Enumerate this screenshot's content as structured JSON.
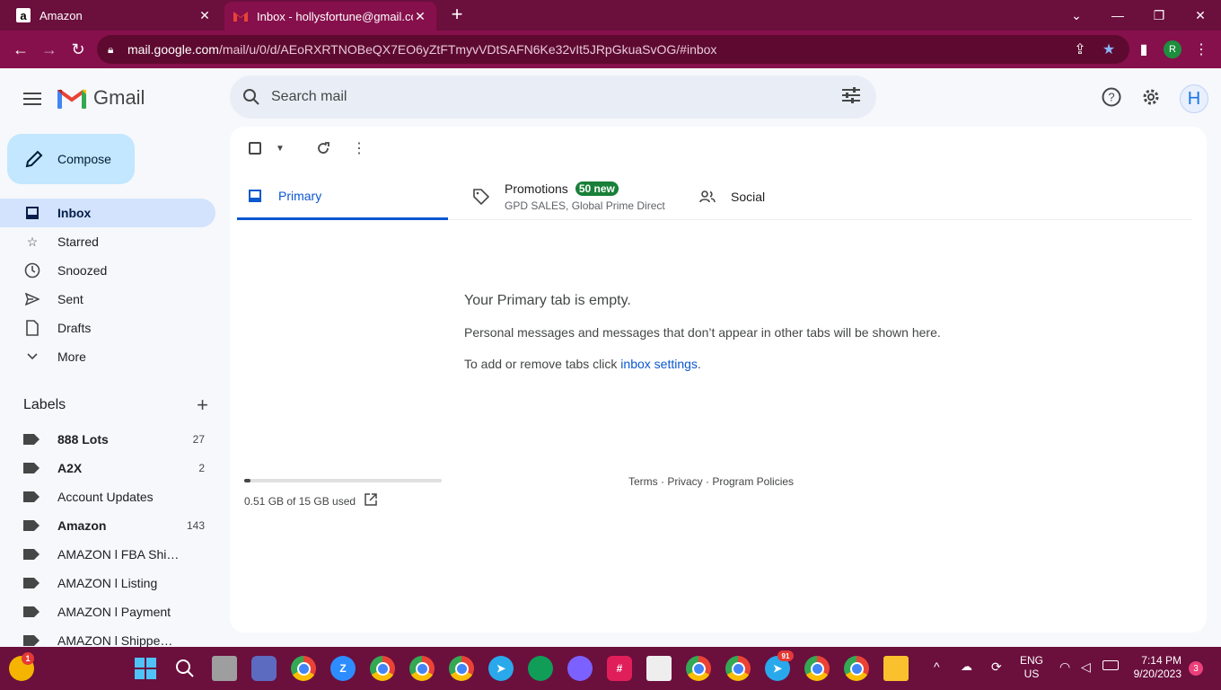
{
  "browser": {
    "tabs": [
      {
        "title": "Amazon",
        "favicon": "amazon-icon"
      },
      {
        "title": "Inbox - hollysfortune@gmail.com",
        "favicon": "gmail-icon"
      }
    ],
    "url_host": "mail.google.com",
    "url_path": "/mail/u/0/d/AEoRXRTNOBeQX7EO6yZtFTmyvVDtSAFN6Ke32vIt5JRpGkuaSvOG/#inbox",
    "profile_initial": "R",
    "theme_color": "#86104c"
  },
  "gmail": {
    "logo_text": "Gmail",
    "search_placeholder": "Search mail",
    "avatar_initial": "H",
    "compose_label": "Compose",
    "nav": [
      {
        "label": "Inbox",
        "icon": "inbox-icon",
        "active": true
      },
      {
        "label": "Starred",
        "icon": "star-icon"
      },
      {
        "label": "Snoozed",
        "icon": "clock-icon"
      },
      {
        "label": "Sent",
        "icon": "send-icon"
      },
      {
        "label": "Drafts",
        "icon": "draft-icon"
      },
      {
        "label": "More",
        "icon": "chevron-down-icon"
      }
    ],
    "labels_title": "Labels",
    "labels": [
      {
        "name": "888 Lots",
        "count": "27",
        "bold": true
      },
      {
        "name": "A2X",
        "count": "2",
        "bold": true
      },
      {
        "name": "Account Updates",
        "count": "",
        "bold": false
      },
      {
        "name": "Amazon",
        "count": "143",
        "bold": true
      },
      {
        "name": "AMAZON l FBA Shipmen...",
        "count": "",
        "bold": false
      },
      {
        "name": "AMAZON l Listing",
        "count": "",
        "bold": false
      },
      {
        "name": "AMAZON l Payment",
        "count": "",
        "bold": false
      },
      {
        "name": "AMAZON l Shipped Order",
        "count": "",
        "bold": false
      }
    ],
    "tabs": {
      "primary": "Primary",
      "promotions": "Promotions",
      "promotions_badge": "50 new",
      "promotions_sub": "GPD SALES, Global Prime Direct",
      "social": "Social"
    },
    "empty": {
      "title": "Your Primary tab is empty.",
      "line1": "Personal messages and messages that don’t appear in other tabs will be shown here.",
      "line2_prefix": "To add or remove tabs click ",
      "line2_link": "inbox settings",
      "line2_suffix": "."
    },
    "storage": {
      "text": "0.51 GB of 15 GB used",
      "used_fraction": 0.034
    },
    "footer": "Terms · Privacy · Program Policies",
    "colors": {
      "accent": "#0b57d0",
      "compose_bg": "#c2e7ff",
      "active_nav": "#d3e3fd",
      "badge": "#188038"
    }
  },
  "taskbar": {
    "time": "7:14 PM",
    "date": "9/20/2023",
    "lang": "ENG",
    "region": "US",
    "notifications": "3",
    "weather_badge": "1",
    "telegram_badge": "91"
  }
}
